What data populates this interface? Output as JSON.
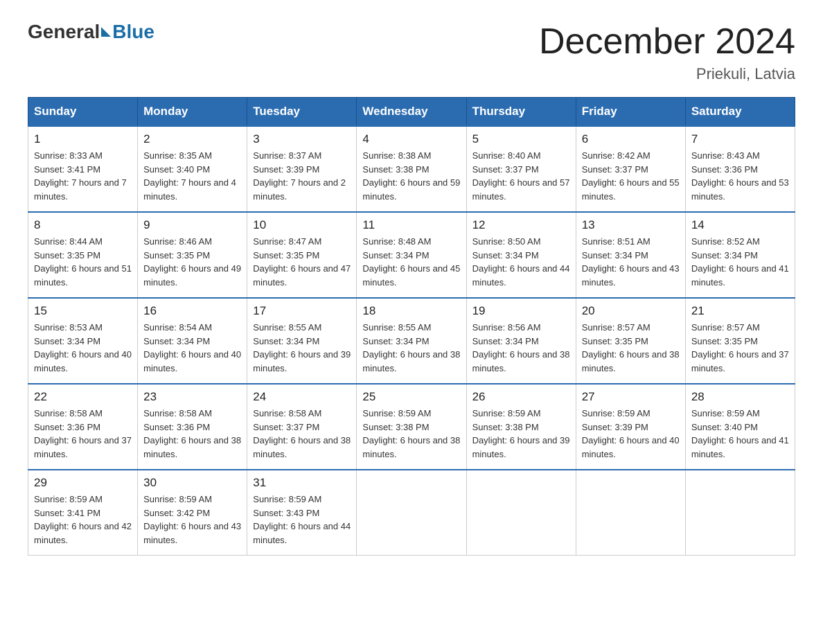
{
  "header": {
    "logo_text_general": "General",
    "logo_text_blue": "Blue",
    "month_title": "December 2024",
    "location": "Priekuli, Latvia"
  },
  "days_of_week": [
    "Sunday",
    "Monday",
    "Tuesday",
    "Wednesday",
    "Thursday",
    "Friday",
    "Saturday"
  ],
  "weeks": [
    [
      {
        "day": "1",
        "sunrise": "Sunrise: 8:33 AM",
        "sunset": "Sunset: 3:41 PM",
        "daylight": "Daylight: 7 hours and 7 minutes."
      },
      {
        "day": "2",
        "sunrise": "Sunrise: 8:35 AM",
        "sunset": "Sunset: 3:40 PM",
        "daylight": "Daylight: 7 hours and 4 minutes."
      },
      {
        "day": "3",
        "sunrise": "Sunrise: 8:37 AM",
        "sunset": "Sunset: 3:39 PM",
        "daylight": "Daylight: 7 hours and 2 minutes."
      },
      {
        "day": "4",
        "sunrise": "Sunrise: 8:38 AM",
        "sunset": "Sunset: 3:38 PM",
        "daylight": "Daylight: 6 hours and 59 minutes."
      },
      {
        "day": "5",
        "sunrise": "Sunrise: 8:40 AM",
        "sunset": "Sunset: 3:37 PM",
        "daylight": "Daylight: 6 hours and 57 minutes."
      },
      {
        "day": "6",
        "sunrise": "Sunrise: 8:42 AM",
        "sunset": "Sunset: 3:37 PM",
        "daylight": "Daylight: 6 hours and 55 minutes."
      },
      {
        "day": "7",
        "sunrise": "Sunrise: 8:43 AM",
        "sunset": "Sunset: 3:36 PM",
        "daylight": "Daylight: 6 hours and 53 minutes."
      }
    ],
    [
      {
        "day": "8",
        "sunrise": "Sunrise: 8:44 AM",
        "sunset": "Sunset: 3:35 PM",
        "daylight": "Daylight: 6 hours and 51 minutes."
      },
      {
        "day": "9",
        "sunrise": "Sunrise: 8:46 AM",
        "sunset": "Sunset: 3:35 PM",
        "daylight": "Daylight: 6 hours and 49 minutes."
      },
      {
        "day": "10",
        "sunrise": "Sunrise: 8:47 AM",
        "sunset": "Sunset: 3:35 PM",
        "daylight": "Daylight: 6 hours and 47 minutes."
      },
      {
        "day": "11",
        "sunrise": "Sunrise: 8:48 AM",
        "sunset": "Sunset: 3:34 PM",
        "daylight": "Daylight: 6 hours and 45 minutes."
      },
      {
        "day": "12",
        "sunrise": "Sunrise: 8:50 AM",
        "sunset": "Sunset: 3:34 PM",
        "daylight": "Daylight: 6 hours and 44 minutes."
      },
      {
        "day": "13",
        "sunrise": "Sunrise: 8:51 AM",
        "sunset": "Sunset: 3:34 PM",
        "daylight": "Daylight: 6 hours and 43 minutes."
      },
      {
        "day": "14",
        "sunrise": "Sunrise: 8:52 AM",
        "sunset": "Sunset: 3:34 PM",
        "daylight": "Daylight: 6 hours and 41 minutes."
      }
    ],
    [
      {
        "day": "15",
        "sunrise": "Sunrise: 8:53 AM",
        "sunset": "Sunset: 3:34 PM",
        "daylight": "Daylight: 6 hours and 40 minutes."
      },
      {
        "day": "16",
        "sunrise": "Sunrise: 8:54 AM",
        "sunset": "Sunset: 3:34 PM",
        "daylight": "Daylight: 6 hours and 40 minutes."
      },
      {
        "day": "17",
        "sunrise": "Sunrise: 8:55 AM",
        "sunset": "Sunset: 3:34 PM",
        "daylight": "Daylight: 6 hours and 39 minutes."
      },
      {
        "day": "18",
        "sunrise": "Sunrise: 8:55 AM",
        "sunset": "Sunset: 3:34 PM",
        "daylight": "Daylight: 6 hours and 38 minutes."
      },
      {
        "day": "19",
        "sunrise": "Sunrise: 8:56 AM",
        "sunset": "Sunset: 3:34 PM",
        "daylight": "Daylight: 6 hours and 38 minutes."
      },
      {
        "day": "20",
        "sunrise": "Sunrise: 8:57 AM",
        "sunset": "Sunset: 3:35 PM",
        "daylight": "Daylight: 6 hours and 38 minutes."
      },
      {
        "day": "21",
        "sunrise": "Sunrise: 8:57 AM",
        "sunset": "Sunset: 3:35 PM",
        "daylight": "Daylight: 6 hours and 37 minutes."
      }
    ],
    [
      {
        "day": "22",
        "sunrise": "Sunrise: 8:58 AM",
        "sunset": "Sunset: 3:36 PM",
        "daylight": "Daylight: 6 hours and 37 minutes."
      },
      {
        "day": "23",
        "sunrise": "Sunrise: 8:58 AM",
        "sunset": "Sunset: 3:36 PM",
        "daylight": "Daylight: 6 hours and 38 minutes."
      },
      {
        "day": "24",
        "sunrise": "Sunrise: 8:58 AM",
        "sunset": "Sunset: 3:37 PM",
        "daylight": "Daylight: 6 hours and 38 minutes."
      },
      {
        "day": "25",
        "sunrise": "Sunrise: 8:59 AM",
        "sunset": "Sunset: 3:38 PM",
        "daylight": "Daylight: 6 hours and 38 minutes."
      },
      {
        "day": "26",
        "sunrise": "Sunrise: 8:59 AM",
        "sunset": "Sunset: 3:38 PM",
        "daylight": "Daylight: 6 hours and 39 minutes."
      },
      {
        "day": "27",
        "sunrise": "Sunrise: 8:59 AM",
        "sunset": "Sunset: 3:39 PM",
        "daylight": "Daylight: 6 hours and 40 minutes."
      },
      {
        "day": "28",
        "sunrise": "Sunrise: 8:59 AM",
        "sunset": "Sunset: 3:40 PM",
        "daylight": "Daylight: 6 hours and 41 minutes."
      }
    ],
    [
      {
        "day": "29",
        "sunrise": "Sunrise: 8:59 AM",
        "sunset": "Sunset: 3:41 PM",
        "daylight": "Daylight: 6 hours and 42 minutes."
      },
      {
        "day": "30",
        "sunrise": "Sunrise: 8:59 AM",
        "sunset": "Sunset: 3:42 PM",
        "daylight": "Daylight: 6 hours and 43 minutes."
      },
      {
        "day": "31",
        "sunrise": "Sunrise: 8:59 AM",
        "sunset": "Sunset: 3:43 PM",
        "daylight": "Daylight: 6 hours and 44 minutes."
      },
      null,
      null,
      null,
      null
    ]
  ]
}
